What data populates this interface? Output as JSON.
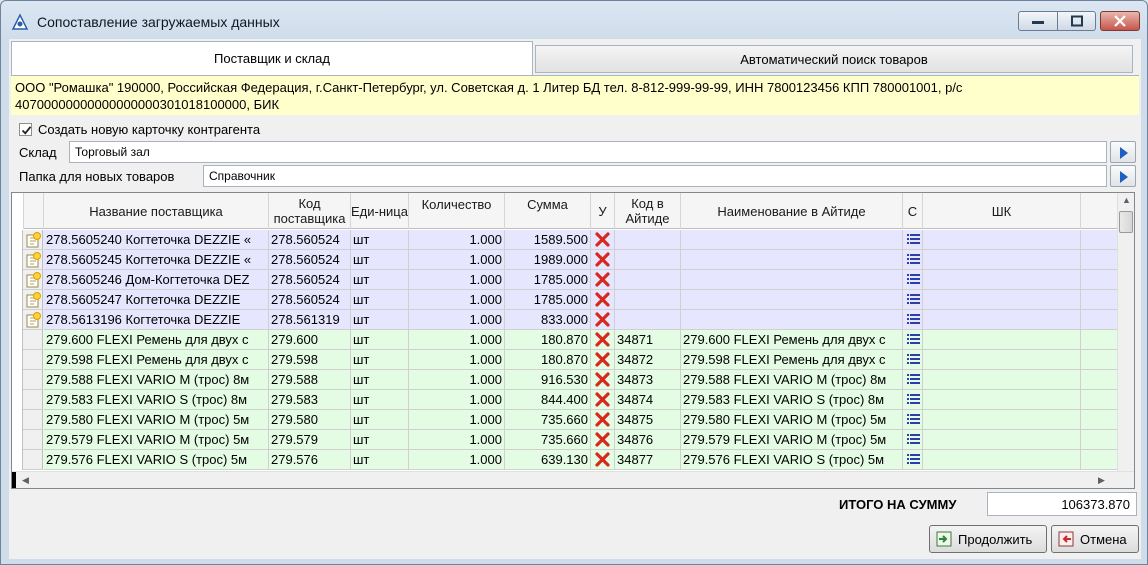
{
  "window": {
    "title": "Сопоставление загружаемых данных"
  },
  "tabs": [
    {
      "label": "Поставщик и склад",
      "active": true
    },
    {
      "label": "Автоматический поиск товаров",
      "active": false
    }
  ],
  "supplier_info": {
    "line1": "ООО \"Ромашка\" 190000, Российская Федерация, г.Санкт-Петербург, ул. Советская д. 1 Литер БД тел. 8-812-999-99-99, ИНН 7800123456 КПП 780001001, р/с",
    "line2": "40700000000000000000301018100000, БИК"
  },
  "create_card": {
    "label": "Создать новую карточку контрагента",
    "checked": true
  },
  "warehouse": {
    "label": "Склад",
    "value": "Торговый зал"
  },
  "folder": {
    "label": "Папка для новых товаров",
    "value": "Справочник"
  },
  "grid": {
    "headers": {
      "name": "Название поставщика",
      "code": "Код поставщика",
      "unit": "Еди-ница",
      "qty": "Количество",
      "sum": "Сумма",
      "u": "У",
      "aitide_code": "Код в Айтиде",
      "aitide_name": "Наименование в Айтиде",
      "c": "С",
      "barcode": "ШК"
    },
    "rows": [
      {
        "kind": "violet",
        "name": "278.5605240  Когтеточка DEZZIE «",
        "code": "278.560524",
        "unit": "шт",
        "qty": "1.000",
        "sum": "1589.500",
        "aitide_code": "",
        "aitide_name": ""
      },
      {
        "kind": "violet",
        "name": "278.5605245  Когтеточка DEZZIE «",
        "code": "278.560524",
        "unit": "шт",
        "qty": "1.000",
        "sum": "1989.000",
        "aitide_code": "",
        "aitide_name": ""
      },
      {
        "kind": "violet",
        "name": "278.5605246  Дом-Когтеточка DEZ",
        "code": "278.560524",
        "unit": "шт",
        "qty": "1.000",
        "sum": "1785.000",
        "aitide_code": "",
        "aitide_name": ""
      },
      {
        "kind": "violet",
        "name": "278.5605247  Когтеточка   DEZZIE",
        "code": "278.560524",
        "unit": "шт",
        "qty": "1.000",
        "sum": "1785.000",
        "aitide_code": "",
        "aitide_name": ""
      },
      {
        "kind": "violet",
        "name": "278.5613196  Когтеточка   DEZZIE",
        "code": "278.561319",
        "unit": "шт",
        "qty": "1.000",
        "sum": "833.000",
        "aitide_code": "",
        "aitide_name": ""
      },
      {
        "kind": "green",
        "name": "279.600   FLEXI  Ремень для двух с",
        "code": "279.600",
        "unit": "шт",
        "qty": "1.000",
        "sum": "180.870",
        "aitide_code": "34871",
        "aitide_name": "279.600   FLEXI  Ремень для двух с"
      },
      {
        "kind": "green",
        "name": "279.598   FLEXI  Ремень для двух с",
        "code": "279.598",
        "unit": "шт",
        "qty": "1.000",
        "sum": "180.870",
        "aitide_code": "34872",
        "aitide_name": "279.598   FLEXI  Ремень для двух с"
      },
      {
        "kind": "green",
        "name": "279.588   FLEXI VARIO M  (трос) 8м",
        "code": "279.588",
        "unit": "шт",
        "qty": "1.000",
        "sum": "916.530",
        "aitide_code": "34873",
        "aitide_name": "279.588   FLEXI VARIO M  (трос) 8м"
      },
      {
        "kind": "green",
        "name": "279.583   FLEXI VARIO S  (трос) 8м",
        "code": "279.583",
        "unit": "шт",
        "qty": "1.000",
        "sum": "844.400",
        "aitide_code": "34874",
        "aitide_name": "279.583   FLEXI VARIO S  (трос) 8м"
      },
      {
        "kind": "green",
        "name": "279.580   FLEXI VARIO M  (трос) 5м",
        "code": "279.580",
        "unit": "шт",
        "qty": "1.000",
        "sum": "735.660",
        "aitide_code": "34875",
        "aitide_name": "279.580   FLEXI VARIO M  (трос) 5м"
      },
      {
        "kind": "green",
        "name": "279.579   FLEXI VARIO M  (трос) 5м",
        "code": "279.579",
        "unit": "шт",
        "qty": "1.000",
        "sum": "735.660",
        "aitide_code": "34876",
        "aitide_name": "279.579   FLEXI VARIO M  (трос) 5м"
      },
      {
        "kind": "green",
        "name": "279.576   FLEXI VARIO S  (трос) 5м",
        "code": "279.576",
        "unit": "шт",
        "qty": "1.000",
        "sum": "639.130",
        "aitide_code": "34877",
        "aitide_name": "279.576   FLEXI VARIO S  (трос) 5м"
      }
    ]
  },
  "total": {
    "label": "ИТОГО НА СУММУ",
    "value": "106373.870"
  },
  "buttons": {
    "continue": "Продолжить",
    "cancel": "Отмена"
  },
  "colors": {
    "new_row": "#e6e6ff",
    "matched_row": "#e4fbe4",
    "reject": "#d8281c",
    "list_icon": "#2c3fa8"
  }
}
